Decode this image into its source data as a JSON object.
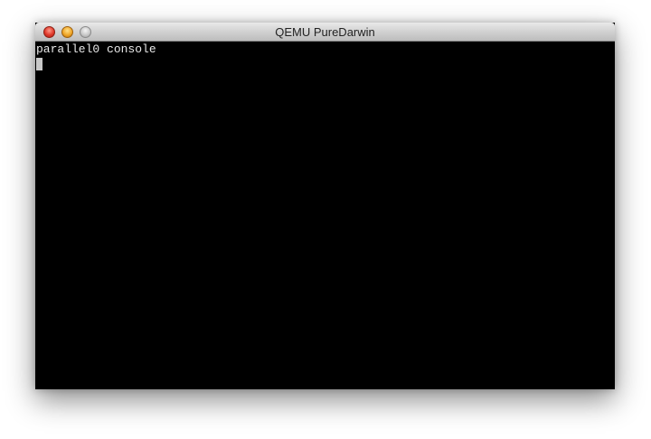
{
  "window": {
    "title": "QEMU PureDarwin",
    "controls": [
      "close-icon",
      "minimize-icon",
      "zoom-icon"
    ]
  },
  "console": {
    "lines": [
      "parallel0 console"
    ],
    "background": "#000000",
    "foreground": "#e8e8e8"
  }
}
